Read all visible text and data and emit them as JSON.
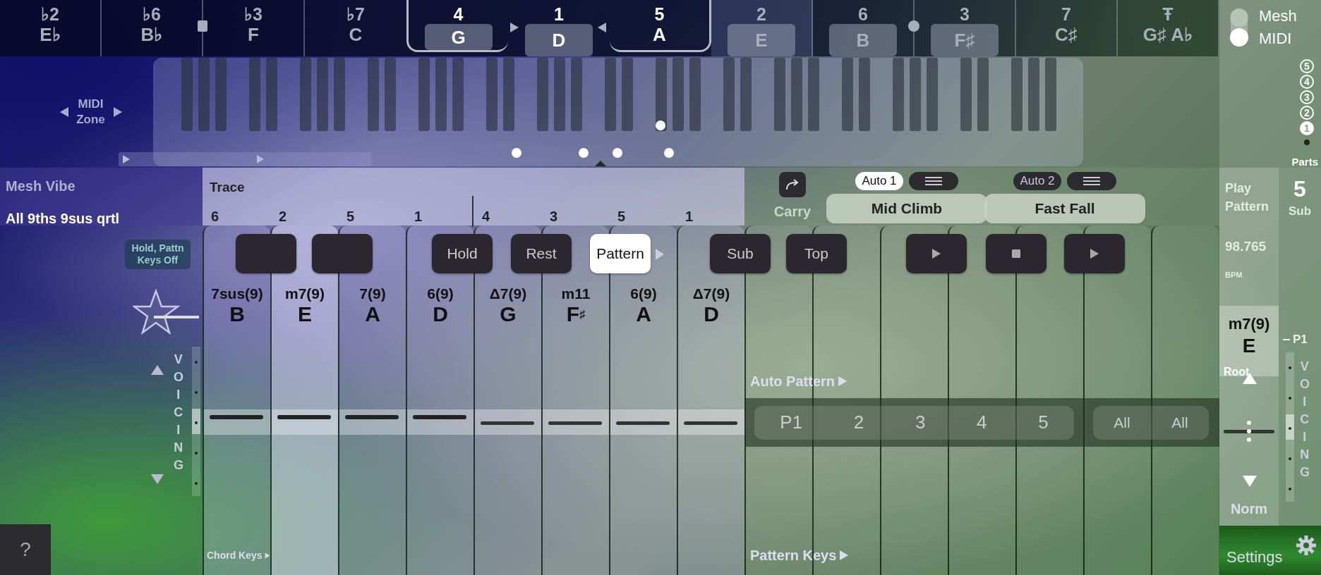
{
  "top_bar": {
    "keys": [
      {
        "degree": "♭2",
        "note": "E♭",
        "selected": false,
        "highlighted": false,
        "pill": false
      },
      {
        "degree": "♭6",
        "note": "B♭",
        "selected": false,
        "highlighted": false,
        "pill": false,
        "square_handle": true
      },
      {
        "degree": "♭3",
        "note": "F",
        "selected": false,
        "highlighted": false,
        "pill": false
      },
      {
        "degree": "♭7",
        "note": "C",
        "selected": false,
        "highlighted": false,
        "pill": false
      },
      {
        "degree": "4",
        "note": "G",
        "selected": false,
        "highlighted": true,
        "pill": true
      },
      {
        "degree": "1",
        "note": "D",
        "selected": false,
        "highlighted": true,
        "pill": true,
        "pointers": true
      },
      {
        "degree": "5",
        "note": "A",
        "selected": false,
        "highlighted": true,
        "pill": false
      },
      {
        "degree": "2",
        "note": "E",
        "selected": true,
        "highlighted": false,
        "pill": true
      },
      {
        "degree": "6",
        "note": "B",
        "selected": false,
        "highlighted": false,
        "pill": true,
        "round_handle": true
      },
      {
        "degree": "3",
        "note": "F♯",
        "selected": false,
        "highlighted": false,
        "pill": true
      },
      {
        "degree": "7",
        "note": "C♯",
        "selected": false,
        "highlighted": false,
        "pill": false
      },
      {
        "degree": "Ŧ",
        "note": "G♯ A♭",
        "selected": false,
        "highlighted": false,
        "pill": false
      }
    ]
  },
  "midi_zone": {
    "label": "MIDI Zone"
  },
  "vibe": {
    "title": "Mesh Vibe",
    "name": "All 9ths 9sus qrtl"
  },
  "trace": {
    "label": "Trace",
    "steps": [
      {
        "label": "6",
        "marked": false
      },
      {
        "label": "2",
        "marked": false
      },
      {
        "label": "5",
        "marked": false
      },
      {
        "label": "1",
        "marked": false
      },
      {
        "label": "4",
        "marked": true
      },
      {
        "label": "3",
        "marked": false
      },
      {
        "label": "5",
        "marked": false
      },
      {
        "label": "1",
        "marked": false
      }
    ]
  },
  "carry": {
    "label": "Carry"
  },
  "autos": [
    {
      "label": "Auto 1",
      "selected": true,
      "pattern": "Mid Climb"
    },
    {
      "label": "Auto 2",
      "selected": false,
      "pattern": "Fast Fall"
    }
  ],
  "hold_badge": "Hold, Pattn Keys Off",
  "buttons": [
    {
      "kind": "blank",
      "selected": false
    },
    {
      "kind": "blank",
      "selected": false
    },
    {
      "kind": "text",
      "label": "Hold",
      "selected": false
    },
    {
      "kind": "text",
      "label": "Rest",
      "selected": false
    },
    {
      "kind": "text",
      "label": "Pattern",
      "selected": true,
      "arrow": true
    },
    {
      "kind": "text",
      "label": "Sub",
      "selected": false
    },
    {
      "kind": "text",
      "label": "Top",
      "selected": false
    },
    {
      "kind": "play",
      "selected": false
    },
    {
      "kind": "stop",
      "selected": false
    },
    {
      "kind": "play",
      "selected": false
    }
  ],
  "chord_keys": [
    {
      "quality": "7sus(9)",
      "root": "B",
      "selected": false,
      "raised": true
    },
    {
      "quality": "m7(9)",
      "root": "E",
      "selected": true,
      "raised": true
    },
    {
      "quality": "7(9)",
      "root": "A",
      "selected": false,
      "raised": true
    },
    {
      "quality": "6(9)",
      "root": "D",
      "selected": false,
      "raised": true
    },
    {
      "quality": "Δ7(9)",
      "root": "G",
      "selected": false,
      "raised": false
    },
    {
      "quality": "m11",
      "root": "F$^{♯}$",
      "selected": false,
      "raised": false
    },
    {
      "quality": "6(9)",
      "root": "A",
      "selected": false,
      "raised": false
    },
    {
      "quality": "Δ7(9)",
      "root": "D",
      "selected": false,
      "raised": false
    }
  ],
  "chord_keys_label": "Chord Keys",
  "pattern_keys_label": "Pattern Keys",
  "auto_pattern": {
    "label": "Auto Pattern",
    "parts": [
      "P1",
      "2",
      "3",
      "4",
      "5"
    ],
    "all": [
      "All",
      "All"
    ]
  },
  "voicing": {
    "label": "VOICING",
    "level": 0.5
  },
  "help": "?",
  "source_toggle": [
    {
      "label": "Mesh",
      "selected": false
    },
    {
      "label": "MIDI",
      "selected": true
    }
  ],
  "parts": [
    {
      "label": "5",
      "selected": false
    },
    {
      "label": "4",
      "selected": false
    },
    {
      "label": "3",
      "selected": false
    },
    {
      "label": "2",
      "selected": false
    },
    {
      "label": "1",
      "selected": true
    }
  ],
  "parts_label": "Parts",
  "play_pattern": "Play Pattern",
  "parts_count": "5",
  "sub_label": "Sub",
  "bpm": "98.765",
  "bpm_unit": "BPM",
  "current_chord": {
    "quality": "m7(9)",
    "root": "E",
    "label": "Root"
  },
  "part_label": "P1",
  "right_voicing": {
    "label": "VOICING",
    "level": 0.5
  },
  "norm": "Norm",
  "settings": "Settings"
}
